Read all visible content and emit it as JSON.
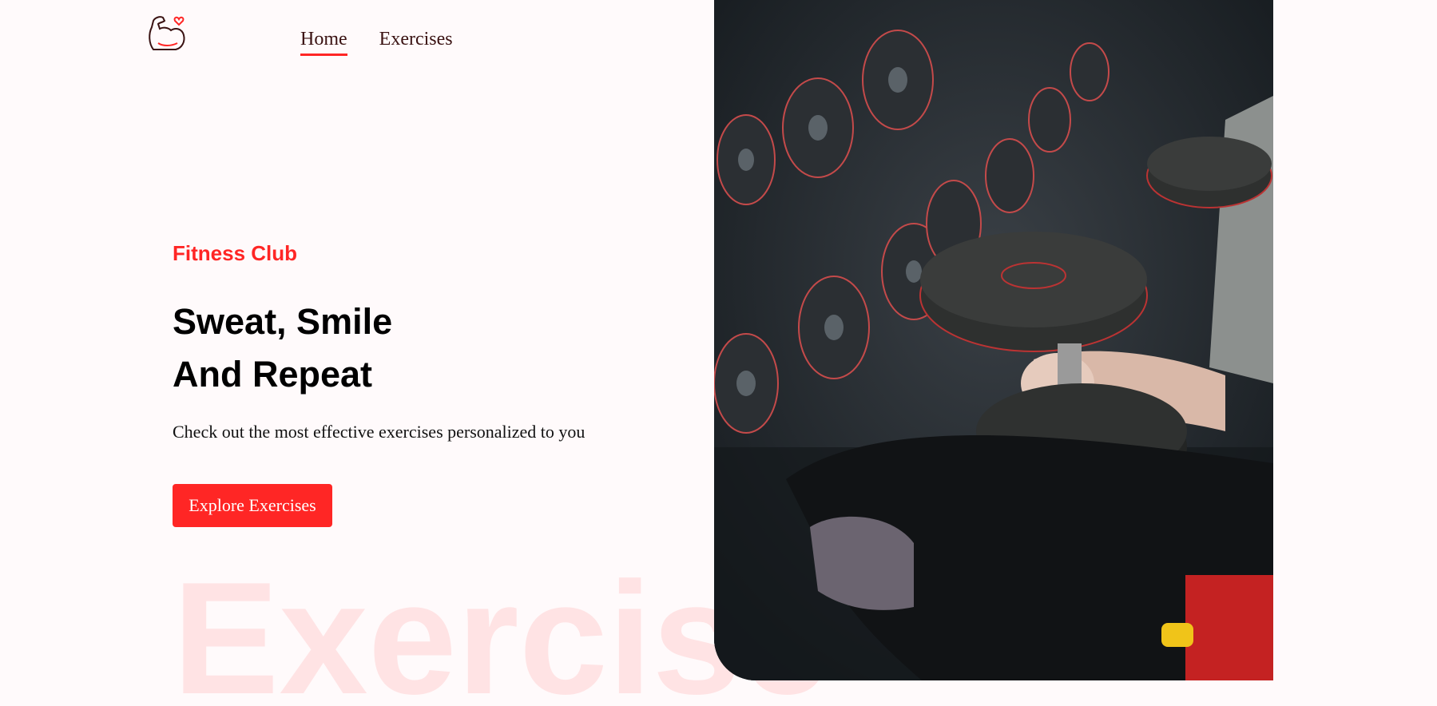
{
  "header": {
    "logo_icon": "flexed-arm-heart-icon",
    "nav": [
      {
        "label": "Home",
        "active": true
      },
      {
        "label": "Exercises",
        "active": false
      }
    ]
  },
  "hero": {
    "eyebrow": "Fitness Club",
    "headline_line1": "Sweat, Smile",
    "headline_line2": "And Repeat",
    "subtitle": "Check out the most effective exercises personalized to you",
    "cta_label": "Explore Exercises",
    "watermark": "Exercise",
    "image_icon": "gym-dumbbell-photo"
  },
  "colors": {
    "accent": "#ff2625",
    "background": "#fffafb"
  }
}
